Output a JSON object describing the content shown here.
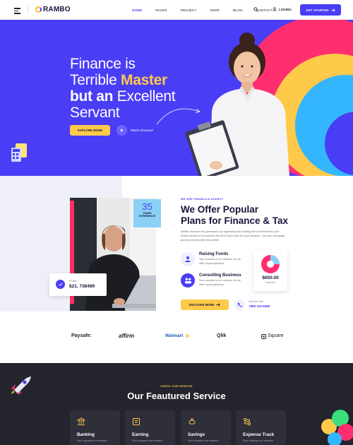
{
  "brand": {
    "name": "RAMBO"
  },
  "nav": {
    "links": [
      {
        "label": "HOME",
        "active": true
      },
      {
        "label": "PAGES",
        "active": false
      },
      {
        "label": "PROJECT",
        "active": false
      },
      {
        "label": "SHOP",
        "active": false
      },
      {
        "label": "BLOG",
        "active": false
      },
      {
        "label": "CONTACT",
        "active": false
      }
    ],
    "login_label": "LOGING",
    "cta_label": "GET STARTED",
    "icons": {
      "menu": "hamburger-icon",
      "search": "search-icon",
      "user": "user-icon",
      "arrow": "arrow-right-icon"
    }
  },
  "hero": {
    "title_line1": "Finance is",
    "title_line2_a": "Terrible ",
    "title_line2_b": "Master",
    "title_line3_a": "but an",
    "title_line3_b": " Excellent",
    "title_line4": "Servant",
    "explore_label": "EXPLORE MORE",
    "watch_label": "Watch Showreel",
    "colors": {
      "bg": "#4a3df6",
      "highlight": "#ffc94a"
    }
  },
  "about": {
    "experience_number": "35",
    "experience_label_1": "YEARS",
    "experience_label_2": "EXPERIENCE",
    "profit_label": "Profits",
    "profit_value": "$21, 738489",
    "eyebrow": "WE ARE FINANCILA AGENCY",
    "title_line1": "We Offer Popular",
    "title_line2": "Plans for Finance & Tax",
    "description": "Middle removes the guesswork by organizing and sharing all the information your broker needs to recommend the best home loan for your situation. Get your mortgage journey moving with less admin.",
    "features": [
      {
        "title": "Raising Funds",
        "text": "Your success is our mission. As we offer expert guidance",
        "icon": "funds-icon"
      },
      {
        "title": "Consulting Business",
        "text": "Your success is our mission. As we offer expert guidance",
        "icon": "consulting-icon"
      }
    ],
    "pie_value": "$650.00",
    "pie_sub": "Expenses",
    "discover_label": "DISCOVER MORE",
    "call_label": "Call Us Free",
    "call_number": "+899 325 6589"
  },
  "brands": [
    "Paysafe:",
    "affirm",
    "Walmart",
    "Qlik",
    "Square"
  ],
  "services": {
    "eyebrow": "CHECK OUR SERVICE",
    "title": "Our Feautured Service",
    "cards": [
      {
        "title": "Banking",
        "text": "Your success our mission",
        "icon": "bank-icon"
      },
      {
        "title": "Earning",
        "text": "Your success our mission",
        "icon": "wallet-icon"
      },
      {
        "title": "Savings",
        "text": "Your success our mission",
        "icon": "savings-icon"
      },
      {
        "title": "Expense Track",
        "text": "Your success our mission",
        "icon": "track-icon"
      }
    ]
  }
}
